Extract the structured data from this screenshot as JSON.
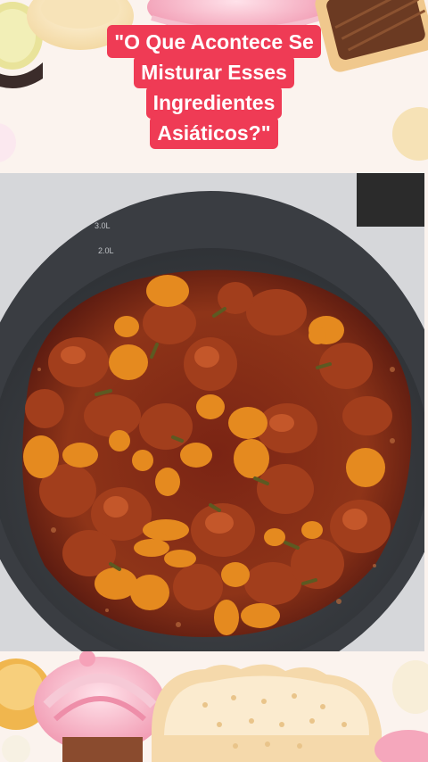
{
  "video": {
    "caption_lines": [
      "\"O Que Acontece Se",
      "Misturar Esses",
      "Ingredientes",
      "Asiáticos?\""
    ],
    "pan_markings": [
      "3.0L",
      "2.0L"
    ],
    "caption_color": "#ef3b55",
    "scene": "pan-with-braised-meat"
  }
}
